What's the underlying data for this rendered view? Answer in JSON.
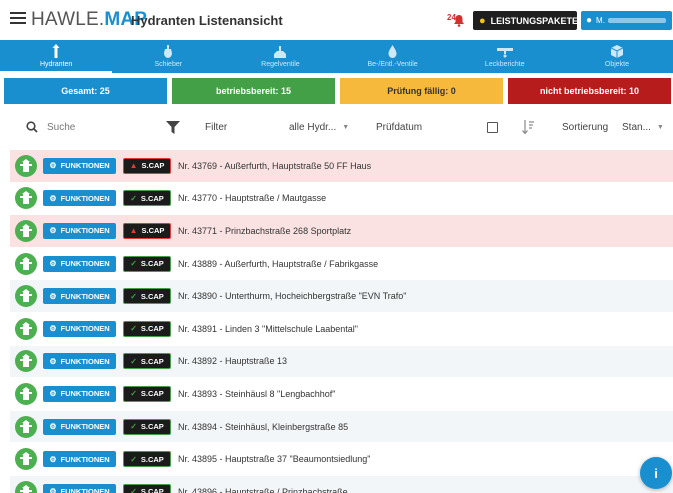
{
  "header": {
    "logo_prefix": "HAWLE.",
    "logo_suffix": "MAP",
    "title": "Hydranten Listenansicht",
    "notification_count": "24",
    "packages_button": "LEISTUNGSPAKETE",
    "user_initial": "M."
  },
  "nav": {
    "items": [
      {
        "label": "Hydranten",
        "icon": "hydrant-icon"
      },
      {
        "label": "Schieber",
        "icon": "valve-icon"
      },
      {
        "label": "Regelventile",
        "icon": "regulator-icon"
      },
      {
        "label": "Be-/Entl.-Ventile",
        "icon": "drop-icon"
      },
      {
        "label": "Leckberichte",
        "icon": "leak-icon"
      },
      {
        "label": "Objekte",
        "icon": "cube-icon"
      }
    ]
  },
  "stats": {
    "total": "Gesamt: 25",
    "ready": "betriebsbereit: 15",
    "due": "Prüfung fällig: 0",
    "not_ready": "nicht betriebsbereit: 10"
  },
  "filters": {
    "search_placeholder": "Suche",
    "filter_label": "Filter",
    "type_value": "alle Hydr...",
    "date_label": "Prüfdatum",
    "sort_label": "Sortierung",
    "sort_value": "Stan..."
  },
  "row_buttons": {
    "functions": "FUNKTIONEN",
    "scap": "S.CAP"
  },
  "rows": [
    {
      "text": "Nr. 43769 - Außerfurth, Hauptstraße 50 FF Haus",
      "alarm": true
    },
    {
      "text": "Nr. 43770 - Hauptstraße / Mautgasse",
      "alarm": false
    },
    {
      "text": "Nr. 43771 - Prinzbachstraße 268 Sportplatz",
      "alarm": true
    },
    {
      "text": "Nr. 43889 - Außerfurth, Hauptstraße / Fabrikgasse",
      "alarm": false
    },
    {
      "text": "Nr. 43890 - Unterthurm, Hocheichbergstraße \"EVN Trafo\"",
      "alarm": false
    },
    {
      "text": "Nr. 43891 - Linden 3 \"Mittelschule Laabental\"",
      "alarm": false
    },
    {
      "text": "Nr. 43892 - Hauptstraße 13",
      "alarm": false
    },
    {
      "text": "Nr. 43893 - Steinhäusl 8 \"Lengbachhof\"",
      "alarm": false
    },
    {
      "text": "Nr. 43894 - Steinhäusl, Kleinbergstraße 85",
      "alarm": false
    },
    {
      "text": "Nr. 43895 - Hauptstraße 37 \"Beaumontsiedlung\"",
      "alarm": false
    },
    {
      "text": "Nr. 43896 - Hauptstraße / Prinzbachstraße",
      "alarm": false
    }
  ],
  "colors": {
    "brand_blue": "#1a8fd0",
    "green": "#43a047",
    "orange": "#f6b93b",
    "red": "#b71c1c",
    "alert_row": "#fbe2e2"
  }
}
